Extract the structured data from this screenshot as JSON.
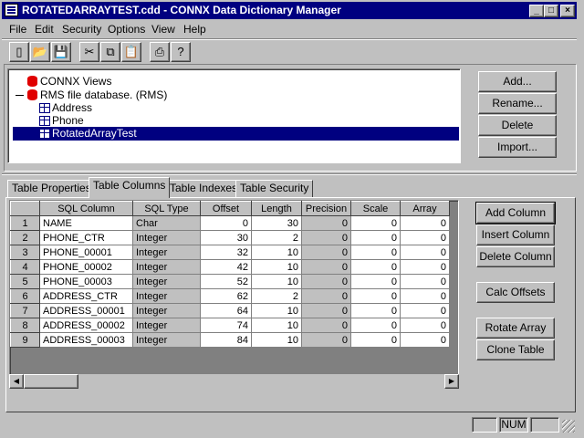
{
  "window": {
    "title": "ROTATEDARRAYTEST.cdd - CONNX Data Dictionary Manager",
    "controls": {
      "minimize": "_",
      "maximize": "□",
      "close": "×"
    }
  },
  "menu": [
    {
      "label": "File"
    },
    {
      "label": "Edit"
    },
    {
      "label": "Security"
    },
    {
      "label": "Options"
    },
    {
      "label": "View"
    },
    {
      "label": "Help"
    }
  ],
  "toolbar": {
    "icons": [
      "new-icon",
      "open-icon",
      "save-icon",
      "cut-icon",
      "copy-icon",
      "paste-icon",
      "print-icon",
      "help-icon"
    ],
    "glyphs": [
      "▯",
      "📂",
      "💾",
      "✂",
      "⧉",
      "📋",
      "⎙",
      "?"
    ]
  },
  "tree": {
    "items": [
      {
        "label": "CONNX Views"
      },
      {
        "label": "RMS file database. (RMS)"
      },
      {
        "label": "Address"
      },
      {
        "label": "Phone"
      },
      {
        "label": "RotatedArrayTest"
      }
    ]
  },
  "tree_buttons": {
    "add": "Add...",
    "rename": "Rename...",
    "delete": "Delete",
    "import": "Import..."
  },
  "tabs": [
    {
      "label": "Table Properties"
    },
    {
      "label": "Table Columns"
    },
    {
      "label": "Table Indexes"
    },
    {
      "label": "Table Security"
    }
  ],
  "grid": {
    "headers": [
      "SQL Column",
      "SQL Type",
      "Offset",
      "Length",
      "Precision",
      "Scale",
      "Array"
    ],
    "rows": [
      {
        "n": "1",
        "col": "NAME",
        "type": "Char",
        "offset": "0",
        "length": "30",
        "precision": "0",
        "scale": "0",
        "array": "0"
      },
      {
        "n": "2",
        "col": "PHONE_CTR",
        "type": "Integer",
        "offset": "30",
        "length": "2",
        "precision": "0",
        "scale": "0",
        "array": "0"
      },
      {
        "n": "3",
        "col": "PHONE_00001",
        "type": "Integer",
        "offset": "32",
        "length": "10",
        "precision": "0",
        "scale": "0",
        "array": "0"
      },
      {
        "n": "4",
        "col": "PHONE_00002",
        "type": "Integer",
        "offset": "42",
        "length": "10",
        "precision": "0",
        "scale": "0",
        "array": "0"
      },
      {
        "n": "5",
        "col": "PHONE_00003",
        "type": "Integer",
        "offset": "52",
        "length": "10",
        "precision": "0",
        "scale": "0",
        "array": "0"
      },
      {
        "n": "6",
        "col": "ADDRESS_CTR",
        "type": "Integer",
        "offset": "62",
        "length": "2",
        "precision": "0",
        "scale": "0",
        "array": "0"
      },
      {
        "n": "7",
        "col": "ADDRESS_00001",
        "type": "Integer",
        "offset": "64",
        "length": "10",
        "precision": "0",
        "scale": "0",
        "array": "0"
      },
      {
        "n": "8",
        "col": "ADDRESS_00002",
        "type": "Integer",
        "offset": "74",
        "length": "10",
        "precision": "0",
        "scale": "0",
        "array": "0"
      },
      {
        "n": "9",
        "col": "ADDRESS_00003",
        "type": "Integer",
        "offset": "84",
        "length": "10",
        "precision": "0",
        "scale": "0",
        "array": "0"
      }
    ]
  },
  "column_buttons": {
    "add_column": "Add Column",
    "insert_column": "Insert Column",
    "delete_column": "Delete Column",
    "calc_offsets": "Calc Offsets",
    "rotate_array": "Rotate Array",
    "clone_table": "Clone Table"
  },
  "status": {
    "num": "NUM"
  },
  "colors": {
    "titlebar": "#000080",
    "selection": "#000080",
    "face": "#c0c0c0",
    "db_icon": "#e00000"
  }
}
